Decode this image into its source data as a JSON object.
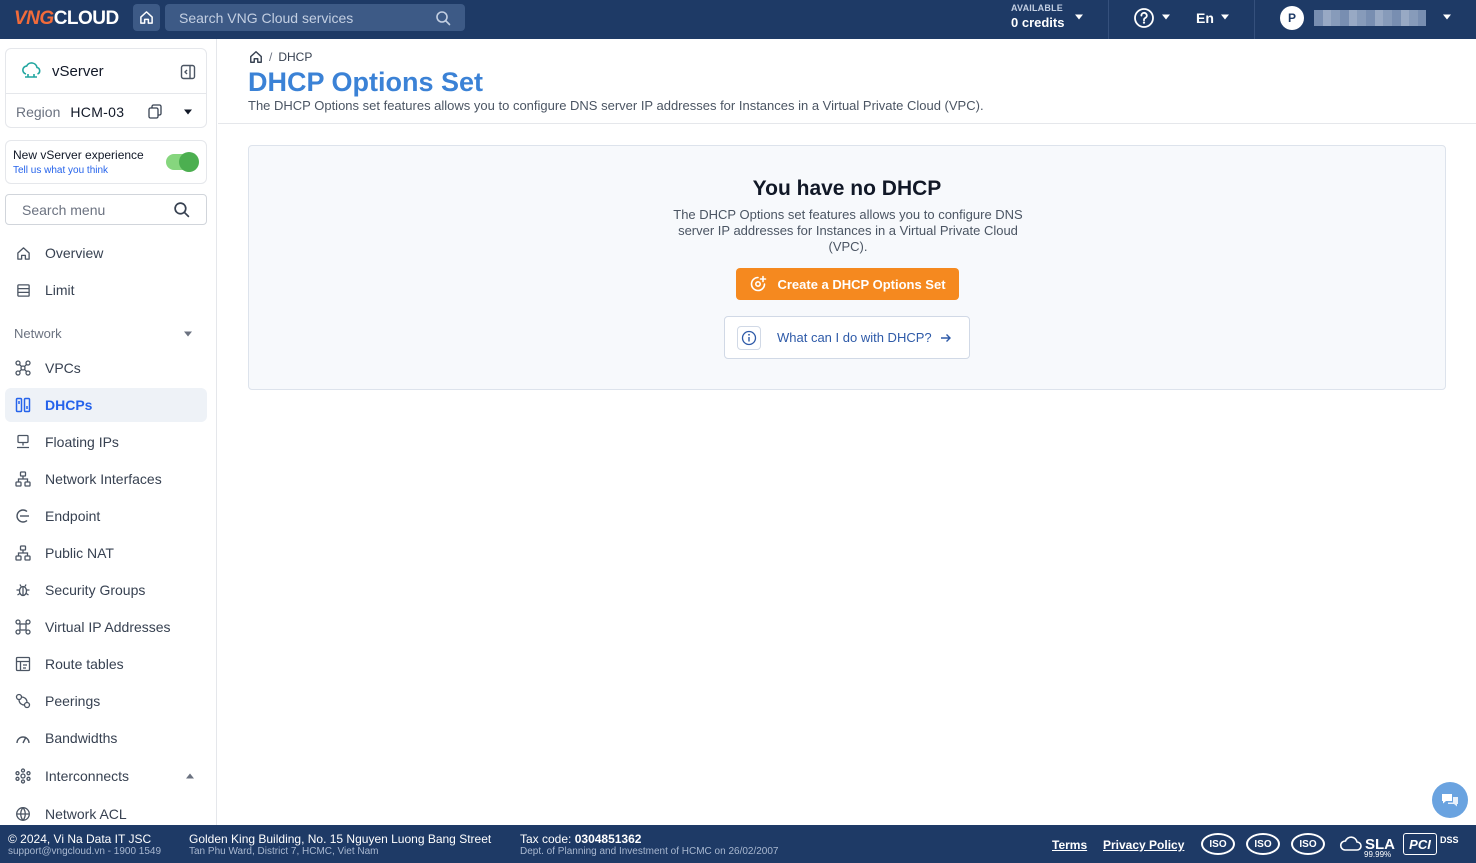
{
  "topbar": {
    "logo_text": "VNG",
    "logo_text_2": "CLOUD",
    "search_placeholder": "Search VNG Cloud services",
    "credits_label": "AVAILABLE",
    "credits_value": "0 credits",
    "language": "En",
    "avatar_initial": "P",
    "icons": [
      "home-icon",
      "search-icon",
      "help-icon",
      "chevron-down-icon"
    ]
  },
  "sidebar": {
    "service_name": "vServer",
    "region_label": "Region",
    "region_value": "HCM-03",
    "experience_title": "New vServer experience",
    "experience_link": "Tell us what you think",
    "experience_toggle_on": true,
    "search_placeholder": "Search menu",
    "items": [
      {
        "label": "Overview",
        "icon": "home-icon"
      },
      {
        "label": "Limit",
        "icon": "limit-icon"
      }
    ],
    "network_section": "Network",
    "network_items": [
      {
        "label": "VPCs",
        "icon": "vpc-icon"
      },
      {
        "label": "DHCPs",
        "icon": "dhcp-icon",
        "active": true
      },
      {
        "label": "Floating IPs",
        "icon": "floating-ip-icon"
      },
      {
        "label": "Network Interfaces",
        "icon": "network-interface-icon"
      },
      {
        "label": "Endpoint",
        "icon": "endpoint-icon"
      },
      {
        "label": "Public NAT",
        "icon": "nat-icon"
      },
      {
        "label": "Security Groups",
        "icon": "security-group-icon"
      },
      {
        "label": "Virtual IP Addresses",
        "icon": "virtual-ip-icon"
      },
      {
        "label": "Route tables",
        "icon": "route-table-icon"
      },
      {
        "label": "Peerings",
        "icon": "peering-icon"
      },
      {
        "label": "Bandwidths",
        "icon": "bandwidth-icon"
      },
      {
        "label": "Interconnects",
        "icon": "interconnect-icon"
      },
      {
        "label": "Network ACL",
        "icon": "network-acl-icon"
      }
    ]
  },
  "main": {
    "breadcrumb_current": "DHCP",
    "title": "DHCP Options Set",
    "description": "The DHCP Options set features allows you to configure DNS server IP addresses for Instances in a Virtual Private Cloud (VPC).",
    "empty_title": "You have no DHCP",
    "empty_description": "The DHCP Options set features allows you to configure DNS server IP addresses for Instances in a Virtual Private Cloud (VPC).",
    "create_button": "Create a DHCP Options Set",
    "help_link": "What can I do with DHCP?"
  },
  "footer": {
    "copyright": "© 2024, Vi Na Data IT JSC",
    "contact": "support@vngcloud.vn - 1900 1549",
    "address": "Golden King Building, No. 15 Nguyen Luong Bang Street",
    "address_sub": "Tan Phu Ward, District 7, HCMC, Viet Nam",
    "tax_label": "Tax code:",
    "tax_code": "0304851362",
    "tax_sub": "Dept. of Planning and Investment of HCMC on 26/02/2007",
    "terms": "Terms",
    "privacy": "Privacy Policy",
    "badges": [
      "ISO",
      "ISO",
      "ISO",
      "SLA",
      "PCI"
    ],
    "sla_sub": "99.99%",
    "pci_sub": "DSS"
  },
  "colors": {
    "topbar": "#1e3a66",
    "accent_blue": "#3b82d6",
    "primary_orange": "#f5891f",
    "active_item": "#2563eb",
    "toggle_on": "#4caf50"
  }
}
